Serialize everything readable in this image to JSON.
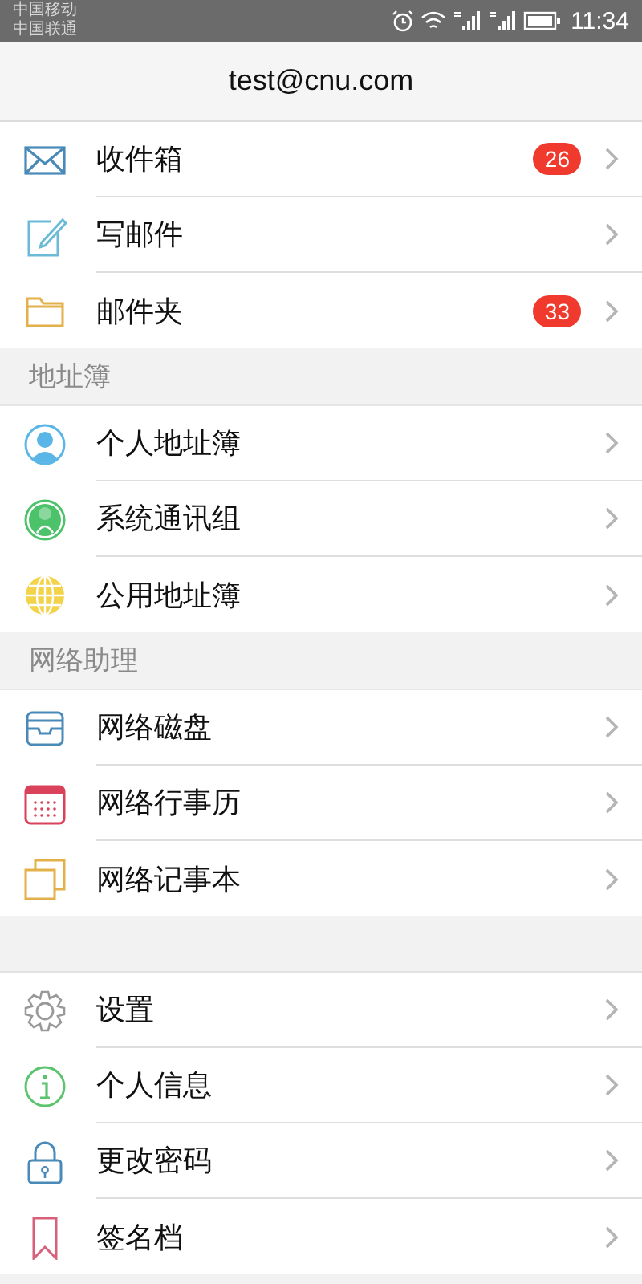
{
  "status_bar": {
    "carriers": [
      "中国移动",
      "中国联通"
    ],
    "time": "11:34"
  },
  "header": {
    "title": "test@cnu.com"
  },
  "groups": [
    {
      "items": [
        {
          "label": "收件箱",
          "badge": "26"
        },
        {
          "label": "写邮件"
        },
        {
          "label": "邮件夹",
          "badge": "33"
        }
      ]
    },
    {
      "heading": "地址簿",
      "items": [
        {
          "label": "个人地址簿"
        },
        {
          "label": "系统通讯组"
        },
        {
          "label": "公用地址簿"
        }
      ]
    },
    {
      "heading": "网络助理",
      "items": [
        {
          "label": "网络磁盘"
        },
        {
          "label": "网络行事历"
        },
        {
          "label": "网络记事本"
        }
      ]
    },
    {
      "items": [
        {
          "label": "设置"
        },
        {
          "label": "个人信息"
        },
        {
          "label": "更改密码"
        },
        {
          "label": "签名档"
        }
      ]
    }
  ]
}
